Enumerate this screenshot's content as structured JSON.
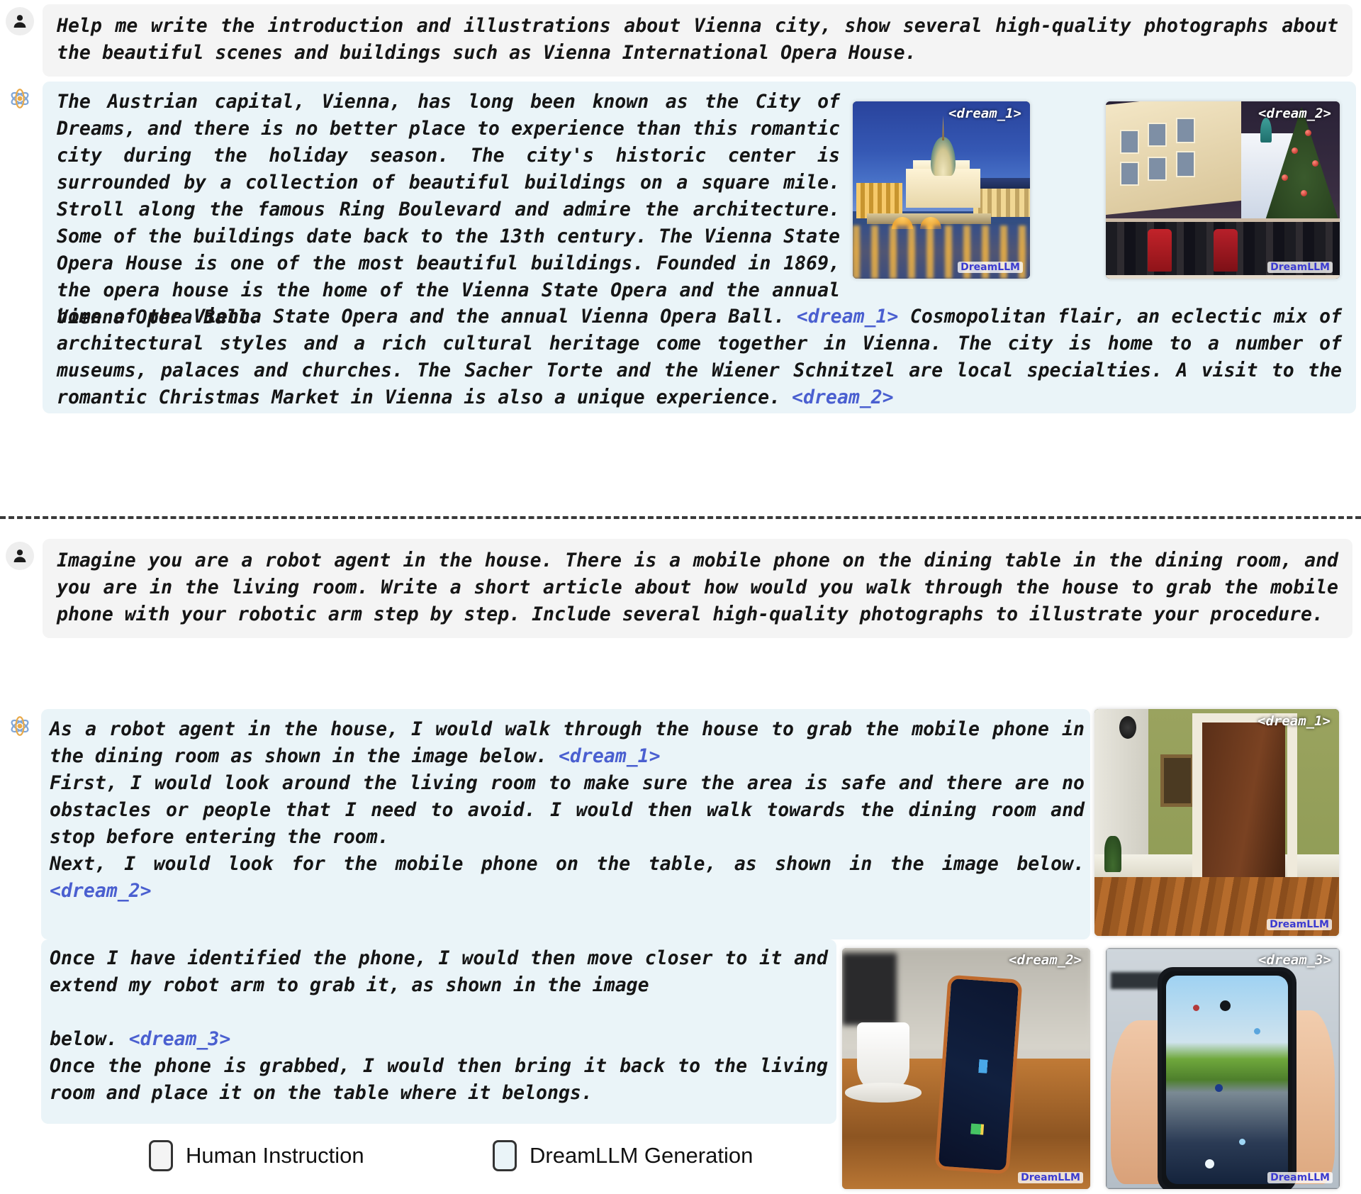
{
  "conversation": {
    "turn1": {
      "role_icon": "user-avatar-icon",
      "text": "Help me write the introduction and illustrations about Vienna city, show several high-quality photographs about the beautiful scenes and buildings such as Vienna International Opera House."
    },
    "turn2": {
      "role_icon": "dreamllm-avatar-icon",
      "para1": "The Austrian capital, Vienna, has long been known as the City of Dreams, and there is no better place to experience than this romantic city during the holiday season. The city's historic center is surrounded by a collection of beautiful buildings on a square mile. Stroll along the famous Ring Boulevard and admire the architecture. Some of the buildings date back to the 13th century. The Vienna State Opera House is one of the most beautiful buildings. Founded in 1869, the opera house is the home of the Vienna State Opera and the annual Vienna Opera Ball.",
      "dream_ref_1": "<dream_1>",
      "para2": "Cosmopolitan flair, an eclectic mix of architectural styles and a rich cultural heritage come together in Vienna. The city is home to a number of museums, palaces and churches. The Sacher Torte and the Wiener Schnitzel are local specialties. A visit to the romantic Christmas Market in Vienna is also a unique experience.",
      "dream_ref_2": "<dream_2>",
      "images": [
        {
          "tag": "<dream_1>",
          "watermark": "DreamLLM",
          "caption": "Vienna riverside at blue hour with illuminated domed building"
        },
        {
          "tag": "<dream_2>",
          "watermark": "DreamLLM",
          "caption": "Vienna Christmas market with crowd and decorated tree"
        }
      ]
    },
    "turn3": {
      "role_icon": "user-avatar-icon",
      "text": "Imagine you are a robot agent in the house. There is a mobile phone on the dining table in the dining room, and you are in the living room. Write a short article about how would you walk through the house to grab the mobile phone with your robotic arm step by step. Include several high-quality photographs to illustrate your procedure."
    },
    "turn4": {
      "role_icon": "dreamllm-avatar-icon",
      "line1": "As a robot agent in the house, I would walk through the house to grab the mobile phone in the dining room as shown in the image below.",
      "dream_ref_1": "<dream_1>",
      "line2": "First, I would look around the living room to make sure the area is safe and there are no obstacles or people that I need to avoid. I would then walk towards the dining room and stop before entering the room.",
      "line3": "Next, I would look for the mobile phone on the table, as shown in the image below.",
      "dream_ref_2": "<dream_2>",
      "line4": "Once I have identified the phone, I would then move closer to it and extend my robot arm to grab it, as shown in the image",
      "line4b": "below.",
      "dream_ref_3": "<dream_3>",
      "line5": "Once the phone is grabbed, I would then bring it back to the living room and place it on the table where it belongs.",
      "images": [
        {
          "tag": "<dream_1>",
          "watermark": "DreamLLM",
          "caption": "Hallway with green walls and open wooden door to dining room"
        },
        {
          "tag": "<dream_2>",
          "watermark": "DreamLLM",
          "caption": "Smartphone standing on wooden table next to a white coffee cup"
        },
        {
          "tag": "<dream_3>",
          "watermark": "DreamLLM",
          "caption": "Hand holding a smartphone displaying a landscape wallpaper"
        }
      ]
    }
  },
  "legend": {
    "human": {
      "label": "Human Instruction",
      "color": "#f4f4f4"
    },
    "ai": {
      "label": "DreamLLM Generation",
      "color": "#eaf4f8"
    }
  },
  "colors": {
    "human_bubble": "#f4f4f4",
    "ai_bubble": "#eaf4f8",
    "dream_token": "#4a5fd0",
    "text": "#151515",
    "watermark": "#3b3bd0"
  }
}
